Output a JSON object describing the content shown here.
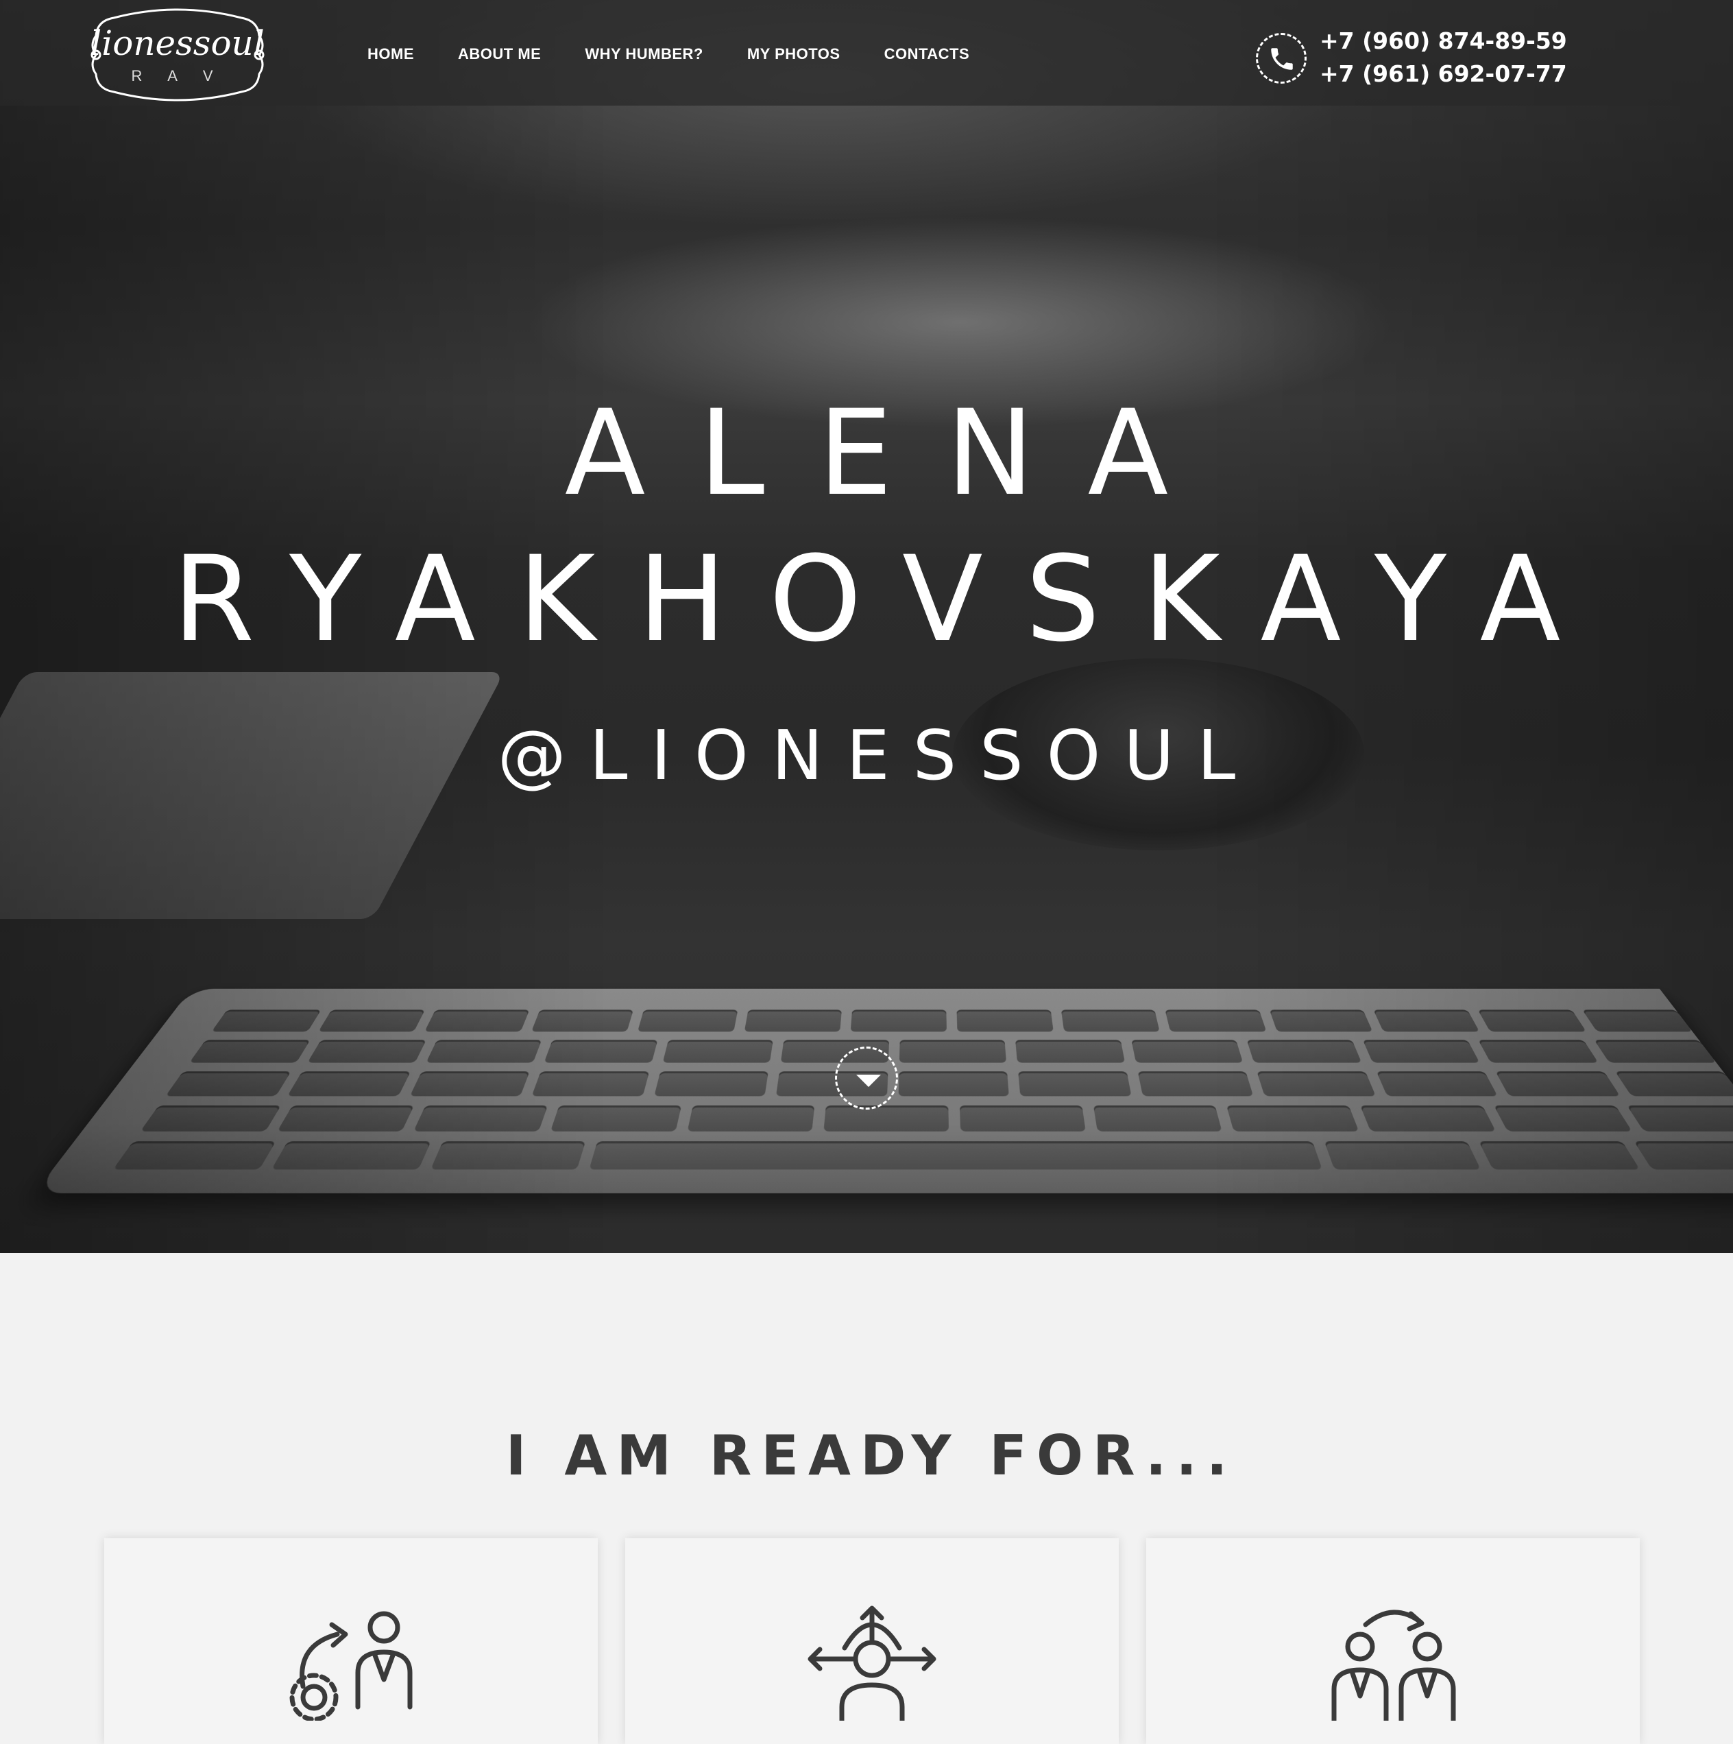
{
  "header": {
    "logo": {
      "script": "lionessoul",
      "sub": "R A V"
    },
    "nav": [
      {
        "label": "HOME"
      },
      {
        "label": "ABOUT ME"
      },
      {
        "label": "WHY HUMBER?"
      },
      {
        "label": "MY PHOTOS"
      },
      {
        "label": "CONTACTS"
      }
    ],
    "phones": [
      "+7 (960) 874-89-59",
      "+7 (961) 692-07-77"
    ]
  },
  "hero": {
    "first_name": "ALENA",
    "last_name": "RYAKHOVSKAYA",
    "handle": "@LIONESSOUL"
  },
  "section": {
    "title": "I AM READY FOR...",
    "cards": [
      {
        "icon": "person-with-gear-cycle-icon"
      },
      {
        "icon": "person-with-arrows-icon"
      },
      {
        "icon": "two-people-exchange-icon"
      }
    ]
  },
  "colors": {
    "header_bg": "#282828",
    "page_bg": "#f2f2f2",
    "title_text": "#3a3a3a",
    "hero_text": "#ffffff"
  }
}
